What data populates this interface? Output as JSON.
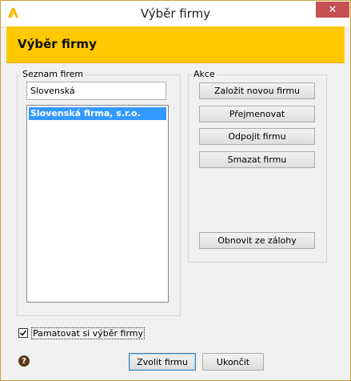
{
  "window": {
    "title": "Výběr firmy",
    "close_glyph": "✕",
    "accent_color": "#ffc800",
    "app_icon": "app-logo-icon"
  },
  "banner": {
    "title": "Výběr firmy"
  },
  "company_list": {
    "group_label": "Seznam firem",
    "search_value": "Slovenská",
    "items": [
      {
        "label": "Slovenská firma, s.r.o.",
        "selected": true
      }
    ]
  },
  "actions": {
    "group_label": "Akce",
    "create": "Založit novou firmu",
    "rename": "Přejmenovat",
    "disconnect": "Odpojit firmu",
    "delete": "Smazat firmu",
    "restore": "Obnovit ze zálohy"
  },
  "remember": {
    "label": "Pamatovat si výběr firmy",
    "checked": true
  },
  "footer": {
    "help_glyph": "?",
    "select_label": "Zvolit firmu",
    "exit_label": "Ukončit"
  }
}
